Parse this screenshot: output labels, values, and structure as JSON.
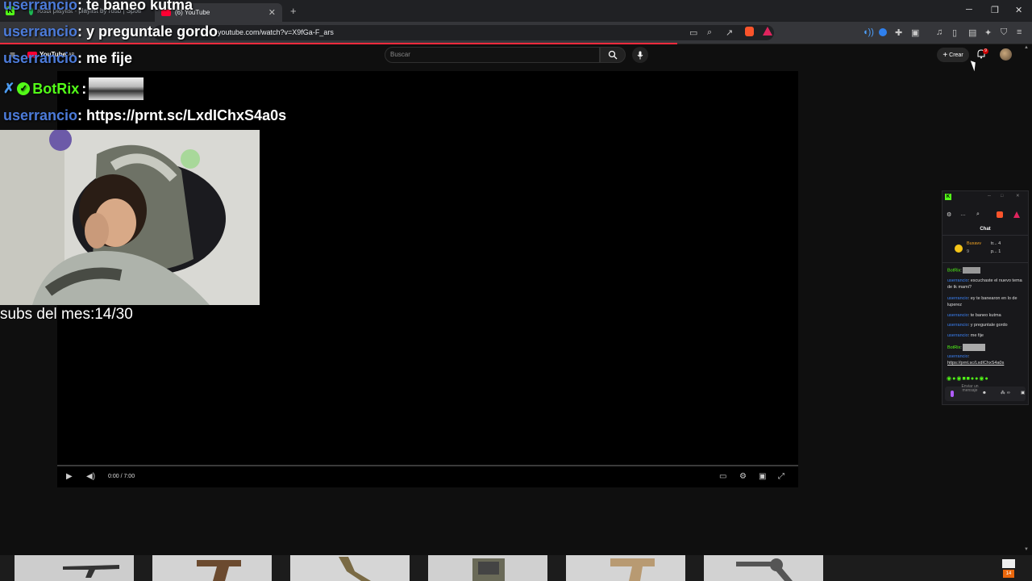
{
  "browser": {
    "tabs": [
      {
        "label": "rosbi playlist - playlist by rosb | Spoti",
        "active": false
      },
      {
        "label": "(6) YouTube",
        "active": true
      }
    ],
    "url": "youtube.com/watch?v=X9fGa-F_ars"
  },
  "youtube": {
    "logo": "YouTube",
    "logo_region": "AR",
    "search_placeholder": "Buscar",
    "create_label": "Crear",
    "notification_count": "9",
    "player": {
      "time": "0:00 / 7:00"
    }
  },
  "chat_overlay": [
    {
      "user": "userrancio",
      "text": ": te baneo kutma"
    },
    {
      "user": "userrancio",
      "text": ": y preguntale gordo"
    },
    {
      "user": "userrancio",
      "text": ": me fije"
    },
    {
      "user": "BotRix",
      "text": ":"
    },
    {
      "user": "userrancio",
      "text": ": https://prnt.sc/LxdIChxS4a0s"
    }
  ],
  "subs_counter": "subs del mes:14/30",
  "kick_popup": {
    "title": "Chat",
    "pinned_user": "Buxavv",
    "pinned_a": "tr...",
    "pinned_a_count": "4",
    "pinned_b": "p...",
    "pinned_b_count": "1",
    "pinned_score": "9",
    "messages": [
      {
        "user": "BotRix",
        "text": ":"
      },
      {
        "user": "userrancio",
        "text": ": escuchaste el nuevo tema de tk mami?"
      },
      {
        "user": "userrancio",
        "text": ": ey te banearon en lo de luperez"
      },
      {
        "user": "userrancio",
        "text": ": te baneo kutma"
      },
      {
        "user": "userrancio",
        "text": ": y preguntale gordo"
      },
      {
        "user": "userrancio",
        "text": ": me fije"
      },
      {
        "user": "BotRix",
        "text": ":"
      },
      {
        "user": "userrancio",
        "text": ":"
      }
    ],
    "link": "https://prnt.sc/LxdIChxS4a0s",
    "input_placeholder": "Enviar un mensaje"
  },
  "taskbar": {
    "mail_badge": "14"
  },
  "colors": {
    "kick_green": "#53fc18",
    "youtube_red": "#ff0033",
    "username_blue": "#4c7bd9"
  }
}
